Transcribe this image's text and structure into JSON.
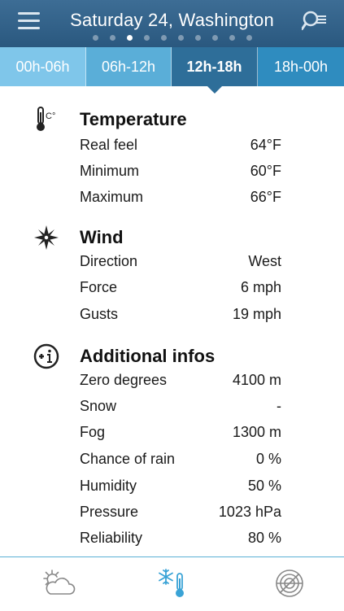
{
  "header": {
    "title": "Saturday 24, Washington",
    "page_count": 10,
    "active_page": 3
  },
  "tabs": [
    {
      "label": "00h-06h"
    },
    {
      "label": "06h-12h"
    },
    {
      "label": "12h-18h",
      "selected": true
    },
    {
      "label": "18h-00h"
    }
  ],
  "temperature": {
    "title": "Temperature",
    "icon": "thermometer-celsius-icon",
    "unit_icon_text": "C°",
    "rows": [
      {
        "label": "Real feel",
        "value": "64°F"
      },
      {
        "label": "Minimum",
        "value": "60°F"
      },
      {
        "label": "Maximum",
        "value": "66°F"
      }
    ]
  },
  "wind": {
    "title": "Wind",
    "icon": "compass-rose-icon",
    "rows": [
      {
        "label": "Direction",
        "value": "West"
      },
      {
        "label": "Force",
        "value": "6 mph"
      },
      {
        "label": "Gusts",
        "value": "19 mph"
      }
    ]
  },
  "additional": {
    "title": "Additional infos",
    "icon": "plus-info-icon",
    "rows": [
      {
        "label": "Zero degrees",
        "value": "4100 m"
      },
      {
        "label": "Snow",
        "value": "-"
      },
      {
        "label": "Fog",
        "value": "1300 m"
      },
      {
        "label": "Chance of rain",
        "value": "0 %"
      },
      {
        "label": "Humidity",
        "value": "50 %"
      },
      {
        "label": "Pressure",
        "value": "1023 hPa"
      },
      {
        "label": "Reliability",
        "value": "80 %"
      }
    ]
  },
  "bottom_nav": [
    {
      "icon": "sun-cloud-icon"
    },
    {
      "icon": "snowflake-thermometer-icon",
      "active": true
    },
    {
      "icon": "radar-icon"
    }
  ],
  "colors": {
    "header": "#2f5e86",
    "accent": "#2f8cbf",
    "active_icon": "#3aa3d6"
  }
}
